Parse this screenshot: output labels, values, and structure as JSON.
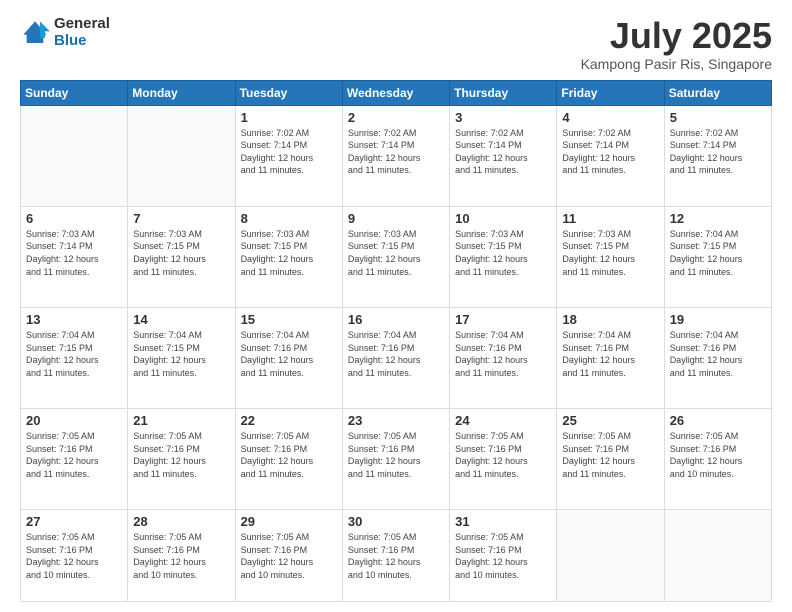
{
  "logo": {
    "general": "General",
    "blue": "Blue"
  },
  "title": "July 2025",
  "subtitle": "Kampong Pasir Ris, Singapore",
  "days_of_week": [
    "Sunday",
    "Monday",
    "Tuesday",
    "Wednesday",
    "Thursday",
    "Friday",
    "Saturday"
  ],
  "weeks": [
    [
      {
        "day": "",
        "empty": true
      },
      {
        "day": "",
        "empty": true
      },
      {
        "day": "1",
        "sunrise": "7:02 AM",
        "sunset": "7:14 PM",
        "daylight": "12 hours and 11 minutes."
      },
      {
        "day": "2",
        "sunrise": "7:02 AM",
        "sunset": "7:14 PM",
        "daylight": "12 hours and 11 minutes."
      },
      {
        "day": "3",
        "sunrise": "7:02 AM",
        "sunset": "7:14 PM",
        "daylight": "12 hours and 11 minutes."
      },
      {
        "day": "4",
        "sunrise": "7:02 AM",
        "sunset": "7:14 PM",
        "daylight": "12 hours and 11 minutes."
      },
      {
        "day": "5",
        "sunrise": "7:02 AM",
        "sunset": "7:14 PM",
        "daylight": "12 hours and 11 minutes."
      }
    ],
    [
      {
        "day": "6",
        "sunrise": "7:03 AM",
        "sunset": "7:14 PM",
        "daylight": "12 hours and 11 minutes."
      },
      {
        "day": "7",
        "sunrise": "7:03 AM",
        "sunset": "7:15 PM",
        "daylight": "12 hours and 11 minutes."
      },
      {
        "day": "8",
        "sunrise": "7:03 AM",
        "sunset": "7:15 PM",
        "daylight": "12 hours and 11 minutes."
      },
      {
        "day": "9",
        "sunrise": "7:03 AM",
        "sunset": "7:15 PM",
        "daylight": "12 hours and 11 minutes."
      },
      {
        "day": "10",
        "sunrise": "7:03 AM",
        "sunset": "7:15 PM",
        "daylight": "12 hours and 11 minutes."
      },
      {
        "day": "11",
        "sunrise": "7:03 AM",
        "sunset": "7:15 PM",
        "daylight": "12 hours and 11 minutes."
      },
      {
        "day": "12",
        "sunrise": "7:04 AM",
        "sunset": "7:15 PM",
        "daylight": "12 hours and 11 minutes."
      }
    ],
    [
      {
        "day": "13",
        "sunrise": "7:04 AM",
        "sunset": "7:15 PM",
        "daylight": "12 hours and 11 minutes."
      },
      {
        "day": "14",
        "sunrise": "7:04 AM",
        "sunset": "7:15 PM",
        "daylight": "12 hours and 11 minutes."
      },
      {
        "day": "15",
        "sunrise": "7:04 AM",
        "sunset": "7:16 PM",
        "daylight": "12 hours and 11 minutes."
      },
      {
        "day": "16",
        "sunrise": "7:04 AM",
        "sunset": "7:16 PM",
        "daylight": "12 hours and 11 minutes."
      },
      {
        "day": "17",
        "sunrise": "7:04 AM",
        "sunset": "7:16 PM",
        "daylight": "12 hours and 11 minutes."
      },
      {
        "day": "18",
        "sunrise": "7:04 AM",
        "sunset": "7:16 PM",
        "daylight": "12 hours and 11 minutes."
      },
      {
        "day": "19",
        "sunrise": "7:04 AM",
        "sunset": "7:16 PM",
        "daylight": "12 hours and 11 minutes."
      }
    ],
    [
      {
        "day": "20",
        "sunrise": "7:05 AM",
        "sunset": "7:16 PM",
        "daylight": "12 hours and 11 minutes."
      },
      {
        "day": "21",
        "sunrise": "7:05 AM",
        "sunset": "7:16 PM",
        "daylight": "12 hours and 11 minutes."
      },
      {
        "day": "22",
        "sunrise": "7:05 AM",
        "sunset": "7:16 PM",
        "daylight": "12 hours and 11 minutes."
      },
      {
        "day": "23",
        "sunrise": "7:05 AM",
        "sunset": "7:16 PM",
        "daylight": "12 hours and 11 minutes."
      },
      {
        "day": "24",
        "sunrise": "7:05 AM",
        "sunset": "7:16 PM",
        "daylight": "12 hours and 11 minutes."
      },
      {
        "day": "25",
        "sunrise": "7:05 AM",
        "sunset": "7:16 PM",
        "daylight": "12 hours and 11 minutes."
      },
      {
        "day": "26",
        "sunrise": "7:05 AM",
        "sunset": "7:16 PM",
        "daylight": "12 hours and 10 minutes."
      }
    ],
    [
      {
        "day": "27",
        "sunrise": "7:05 AM",
        "sunset": "7:16 PM",
        "daylight": "12 hours and 10 minutes."
      },
      {
        "day": "28",
        "sunrise": "7:05 AM",
        "sunset": "7:16 PM",
        "daylight": "12 hours and 10 minutes."
      },
      {
        "day": "29",
        "sunrise": "7:05 AM",
        "sunset": "7:16 PM",
        "daylight": "12 hours and 10 minutes."
      },
      {
        "day": "30",
        "sunrise": "7:05 AM",
        "sunset": "7:16 PM",
        "daylight": "12 hours and 10 minutes."
      },
      {
        "day": "31",
        "sunrise": "7:05 AM",
        "sunset": "7:16 PM",
        "daylight": "12 hours and 10 minutes."
      },
      {
        "day": "",
        "empty": true
      },
      {
        "day": "",
        "empty": true
      }
    ]
  ],
  "labels": {
    "sunrise": "Sunrise:",
    "sunset": "Sunset:",
    "daylight": "Daylight:"
  }
}
